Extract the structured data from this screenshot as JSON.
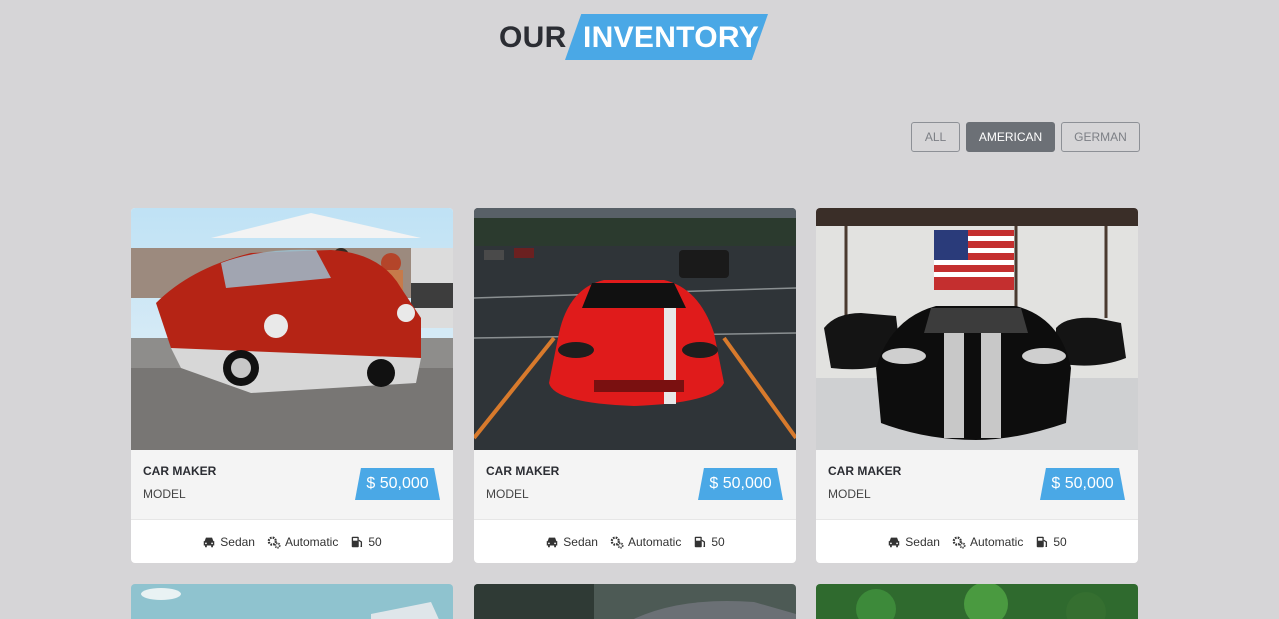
{
  "header": {
    "title_part1": "OUR",
    "title_part2": "INVENTORY"
  },
  "filters": [
    {
      "label": "ALL",
      "active": false
    },
    {
      "label": "AMERICAN",
      "active": true
    },
    {
      "label": "GERMAN",
      "active": false
    }
  ],
  "cars": [
    {
      "maker": "CAR MAKER",
      "model": "MODEL",
      "price": "$ 50,000",
      "body": "Sedan",
      "transmission": "Automatic",
      "fuel": "50"
    },
    {
      "maker": "CAR MAKER",
      "model": "MODEL",
      "price": "$ 50,000",
      "body": "Sedan",
      "transmission": "Automatic",
      "fuel": "50"
    },
    {
      "maker": "CAR MAKER",
      "model": "MODEL",
      "price": "$ 50,000",
      "body": "Sedan",
      "transmission": "Automatic",
      "fuel": "50"
    }
  ],
  "colors": {
    "accent": "#4aa8e6",
    "background": "#d6d5d7",
    "active_filter": "#6c7076"
  },
  "icons": {
    "body": "car-icon",
    "transmission": "gears-icon",
    "fuel": "fuel-pump-icon"
  }
}
